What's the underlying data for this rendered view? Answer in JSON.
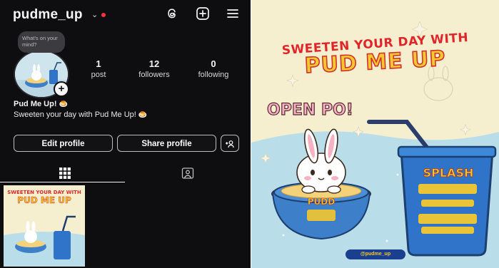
{
  "profile": {
    "username": "pudme_up",
    "note_text": "What's on your mind?",
    "stats": [
      {
        "value": "1",
        "label": "post"
      },
      {
        "value": "12",
        "label": "followers"
      },
      {
        "value": "0",
        "label": "following"
      }
    ],
    "display_name": "Pud Me Up!",
    "bio": "Sweeten your day with Pud Me Up!",
    "buttons": {
      "edit": "Edit profile",
      "share": "Share profile"
    }
  },
  "poster": {
    "title_line1": "SWEETEN YOUR DAY WITH",
    "title_line2": "PUD ME UP",
    "open_po": "OPEN PO!",
    "drink_label": "SPLASH",
    "pudding_label": "PUDD",
    "handle_pill": "@pudme_up"
  },
  "colors": {
    "app_background": "#0e0e11",
    "notification_dot": "#ff3040",
    "poster_cream": "#f5efcf",
    "poster_sky": "#b9deea",
    "title_red": "#e0262b",
    "title_yellow": "#f4c82f",
    "cup_blue": "#2f74c8"
  },
  "icons": [
    "chevron-down-icon",
    "threads-icon",
    "create-plus-icon",
    "menu-icon",
    "add-story-icon",
    "discover-people-icon",
    "grid-tab-icon",
    "tagged-tab-icon"
  ]
}
